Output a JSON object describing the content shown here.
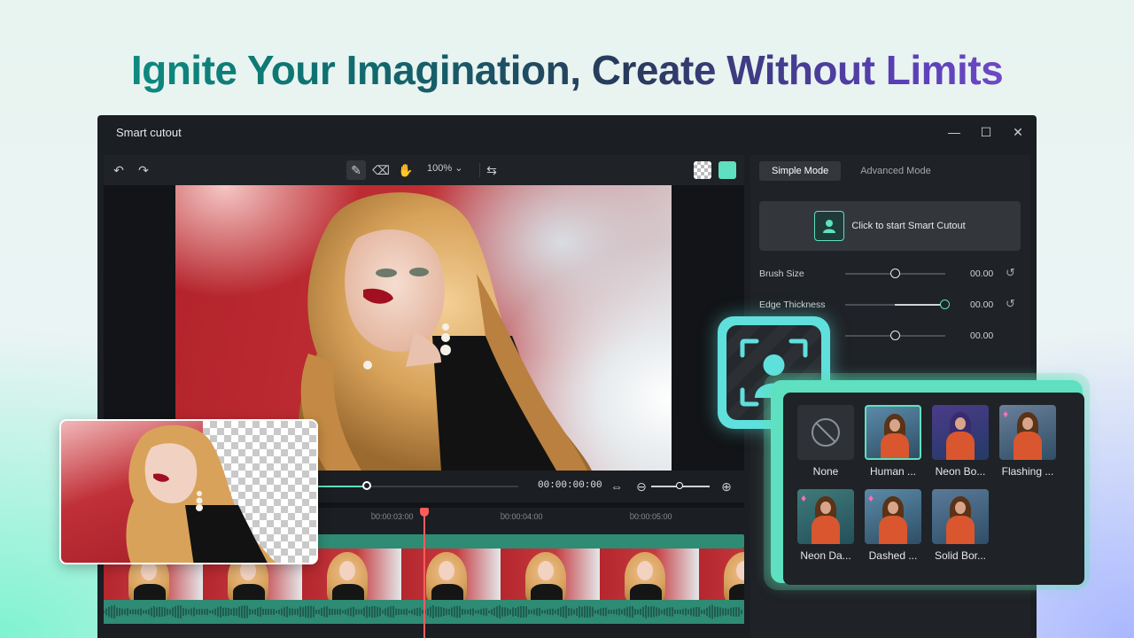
{
  "headline": "Ignite Your Imagination, Create Without Limits",
  "window": {
    "title": "Smart cutout",
    "controls": {
      "minimize": "—",
      "maximize": "☐",
      "close": "✕"
    }
  },
  "toolbar": {
    "undo_icon": "↶",
    "redo_icon": "↷",
    "brush_icon": "✎",
    "eraser_icon": "⌫",
    "hand_icon": "✋",
    "zoom": "100%",
    "zoom_caret": "⌄",
    "compare_icon": "⇆"
  },
  "playback": {
    "timecode": "00:00:00:00",
    "progress": 0.25
  },
  "timeline": {
    "marks": [
      "00:00:03:00",
      "00:00:04:00",
      "00:00:05:00"
    ]
  },
  "panel": {
    "tabs": [
      {
        "label": "Simple Mode",
        "active": true
      },
      {
        "label": "Advanced Mode",
        "active": false
      }
    ],
    "start_button": "Click to start Smart Cutout",
    "sliders": [
      {
        "label": "Brush Size",
        "value": "00.00",
        "level": 0.5,
        "reset": "↺"
      },
      {
        "label": "Edge Thickness",
        "value": "00.00",
        "level": 1.0,
        "reset": "↺"
      },
      {
        "label": "",
        "value": "00.00",
        "level": 0.5,
        "reset": ""
      }
    ]
  },
  "effects": [
    {
      "label": "None",
      "premium": false,
      "selected": false
    },
    {
      "label": "Human ...",
      "premium": false,
      "selected": true
    },
    {
      "label": "Neon Bo...",
      "premium": false,
      "selected": false
    },
    {
      "label": "Flashing ...",
      "premium": true,
      "selected": false
    },
    {
      "label": "Neon Da...",
      "premium": true,
      "selected": false
    },
    {
      "label": "Dashed ...",
      "premium": true,
      "selected": false
    },
    {
      "label": "Solid Bor...",
      "premium": false,
      "selected": false
    }
  ],
  "colors": {
    "accent": "#5fe0c0",
    "playhead": "#ff5c5c",
    "panel": "#1f2226"
  }
}
